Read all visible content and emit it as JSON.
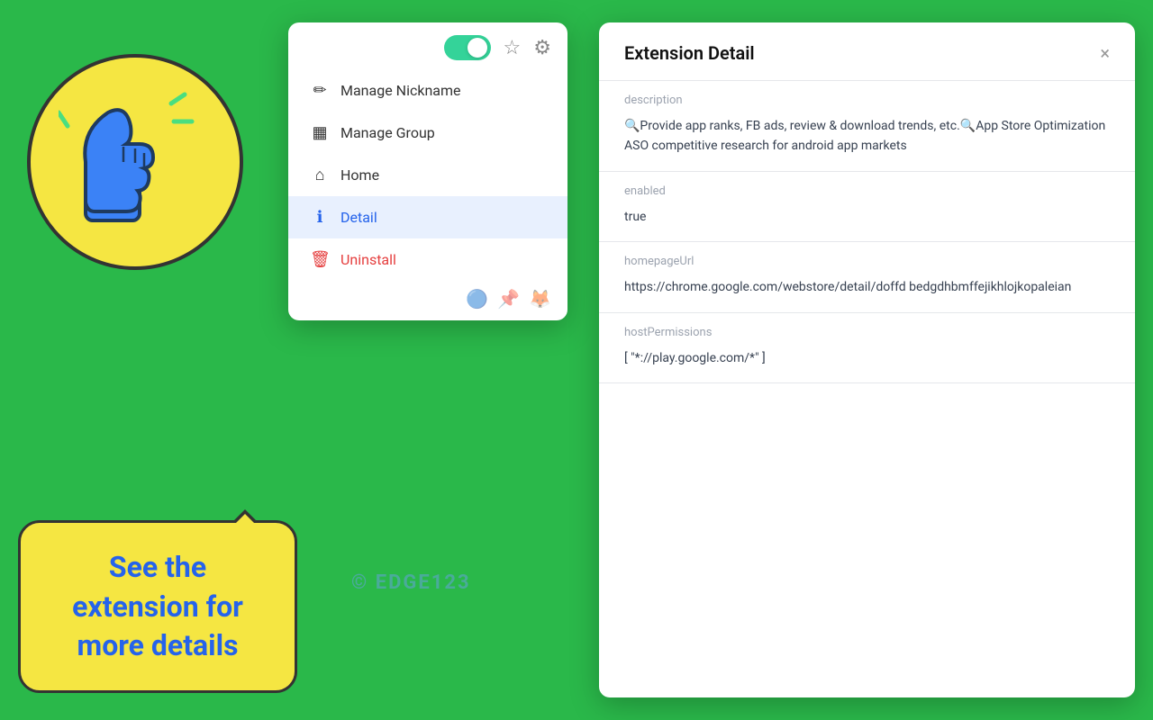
{
  "background_color": "#2ab84a",
  "thumbs_circle": {
    "bg_color": "#f5e642"
  },
  "speech_bubble": {
    "text_line1": "See the",
    "text_line2": "extension for",
    "text_line3": "more details",
    "bg_color": "#f5e642",
    "text_color": "#2563eb"
  },
  "popup_menu": {
    "toggle_active": true,
    "toggle_color": "#34d399",
    "star_icon": "☆",
    "gear_icon": "⚙",
    "items": [
      {
        "icon": "✏",
        "label": "Manage Nickname",
        "active": false,
        "danger": false
      },
      {
        "icon": "▦",
        "label": "Manage Group",
        "active": false,
        "danger": false
      },
      {
        "icon": "⌂",
        "label": "Home",
        "active": false,
        "danger": false
      },
      {
        "icon": "ℹ",
        "label": "Detail",
        "active": true,
        "danger": false
      },
      {
        "icon": "🗑",
        "label": "Uninstall",
        "active": false,
        "danger": true
      }
    ]
  },
  "extension_detail": {
    "title": "Extension Detail",
    "close_label": "×",
    "fields": [
      {
        "label": "description",
        "value": "🔍Provide app ranks, FB ads, review & download trends, etc.🔍App Store Optimization ASO competitive research for android app markets"
      },
      {
        "label": "enabled",
        "value": "true"
      },
      {
        "label": "homepageUrl",
        "value": "https://chrome.google.com/webstore/detail/doffd bedgdhbmffejikhlojkopaleian"
      },
      {
        "label": "hostPermissions",
        "value": "[ \"*://play.google.com/*\" ]"
      }
    ]
  },
  "watermark": "© EDGE123"
}
